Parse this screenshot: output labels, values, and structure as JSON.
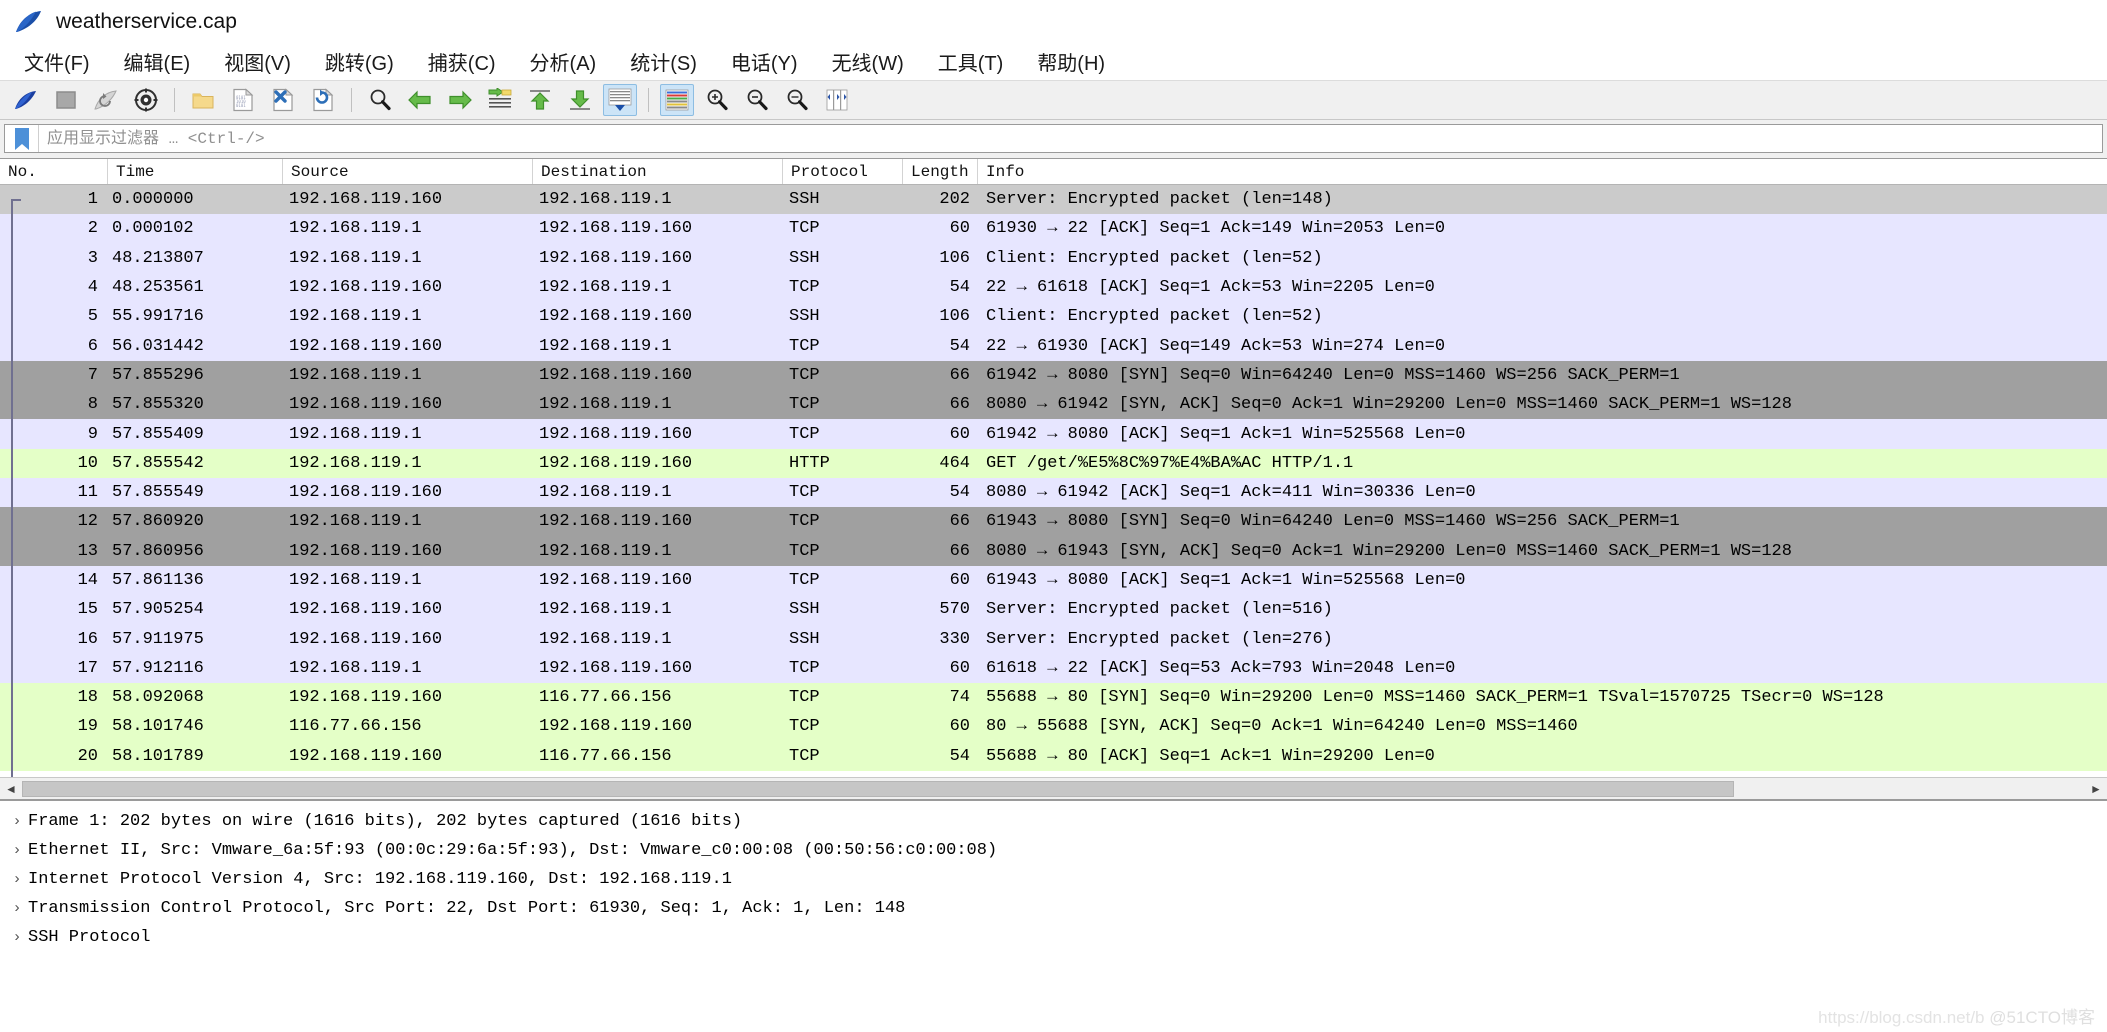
{
  "window": {
    "title": "weatherservice.cap",
    "app_icon": "wireshark-fin-icon"
  },
  "menubar": {
    "items": [
      {
        "label": "文件(F)",
        "name": "menu-file"
      },
      {
        "label": "编辑(E)",
        "name": "menu-edit"
      },
      {
        "label": "视图(V)",
        "name": "menu-view"
      },
      {
        "label": "跳转(G)",
        "name": "menu-go"
      },
      {
        "label": "捕获(C)",
        "name": "menu-capture"
      },
      {
        "label": "分析(A)",
        "name": "menu-analyze"
      },
      {
        "label": "统计(S)",
        "name": "menu-statistics"
      },
      {
        "label": "电话(Y)",
        "name": "menu-telephony"
      },
      {
        "label": "无线(W)",
        "name": "menu-wireless"
      },
      {
        "label": "工具(T)",
        "name": "menu-tools"
      },
      {
        "label": "帮助(H)",
        "name": "menu-help"
      }
    ]
  },
  "toolbar": {
    "buttons": [
      {
        "name": "start-capture-icon",
        "active": false
      },
      {
        "name": "stop-capture-icon",
        "active": false
      },
      {
        "name": "restart-capture-icon",
        "active": false
      },
      {
        "name": "capture-options-icon",
        "active": false
      },
      {
        "sep": true
      },
      {
        "name": "open-file-icon",
        "active": false
      },
      {
        "name": "save-file-icon",
        "active": false
      },
      {
        "name": "close-file-icon",
        "active": false
      },
      {
        "name": "reload-file-icon",
        "active": false
      },
      {
        "sep": true
      },
      {
        "name": "find-packet-icon",
        "active": false
      },
      {
        "name": "go-back-icon",
        "active": false
      },
      {
        "name": "go-forward-icon",
        "active": false
      },
      {
        "name": "go-to-packet-icon",
        "active": false
      },
      {
        "name": "go-to-first-packet-icon",
        "active": false
      },
      {
        "name": "go-to-last-packet-icon",
        "active": false
      },
      {
        "name": "auto-scroll-icon",
        "active": true
      },
      {
        "sep": true
      },
      {
        "name": "colorize-packets-icon",
        "active": true
      },
      {
        "name": "zoom-in-icon",
        "active": false
      },
      {
        "name": "zoom-out-icon",
        "active": false
      },
      {
        "name": "normal-size-icon",
        "active": false
      },
      {
        "name": "resize-columns-icon",
        "active": false
      }
    ]
  },
  "filter": {
    "bookmark_icon": "bookmark-icon",
    "value": "",
    "placeholder": "应用显示过滤器 … <Ctrl-/>"
  },
  "packet_list": {
    "columns": [
      "No.",
      "Time",
      "Source",
      "Destination",
      "Protocol",
      "Length",
      "Info"
    ],
    "rows": [
      {
        "no": "1",
        "time": "0.000000",
        "src": "192.168.119.160",
        "dst": "192.168.119.1",
        "proto": "SSH",
        "len": "202",
        "info": "Server: Encrypted packet (len=148)",
        "style": "selected"
      },
      {
        "no": "2",
        "time": "0.000102",
        "src": "192.168.119.1",
        "dst": "192.168.119.160",
        "proto": "TCP",
        "len": "60",
        "info": "61930 → 22 [ACK] Seq=1 Ack=149 Win=2053 Len=0",
        "style": "tcp"
      },
      {
        "no": "3",
        "time": "48.213807",
        "src": "192.168.119.1",
        "dst": "192.168.119.160",
        "proto": "SSH",
        "len": "106",
        "info": "Client: Encrypted packet (len=52)",
        "style": "tcp"
      },
      {
        "no": "4",
        "time": "48.253561",
        "src": "192.168.119.160",
        "dst": "192.168.119.1",
        "proto": "TCP",
        "len": "54",
        "info": "22 → 61618 [ACK] Seq=1 Ack=53 Win=2205 Len=0",
        "style": "tcp"
      },
      {
        "no": "5",
        "time": "55.991716",
        "src": "192.168.119.1",
        "dst": "192.168.119.160",
        "proto": "SSH",
        "len": "106",
        "info": "Client: Encrypted packet (len=52)",
        "style": "tcp"
      },
      {
        "no": "6",
        "time": "56.031442",
        "src": "192.168.119.160",
        "dst": "192.168.119.1",
        "proto": "TCP",
        "len": "54",
        "info": "22 → 61930 [ACK] Seq=149 Ack=53 Win=274 Len=0",
        "style": "tcp"
      },
      {
        "no": "7",
        "time": "57.855296",
        "src": "192.168.119.1",
        "dst": "192.168.119.160",
        "proto": "TCP",
        "len": "66",
        "info": "61942 → 8080 [SYN] Seq=0 Win=64240 Len=0 MSS=1460 WS=256 SACK_PERM=1",
        "style": "syn"
      },
      {
        "no": "8",
        "time": "57.855320",
        "src": "192.168.119.160",
        "dst": "192.168.119.1",
        "proto": "TCP",
        "len": "66",
        "info": "8080 → 61942 [SYN, ACK] Seq=0 Ack=1 Win=29200 Len=0 MSS=1460 SACK_PERM=1 WS=128",
        "style": "syn"
      },
      {
        "no": "9",
        "time": "57.855409",
        "src": "192.168.119.1",
        "dst": "192.168.119.160",
        "proto": "TCP",
        "len": "60",
        "info": "61942 → 8080 [ACK] Seq=1 Ack=1 Win=525568 Len=0",
        "style": "tcp"
      },
      {
        "no": "10",
        "time": "57.855542",
        "src": "192.168.119.1",
        "dst": "192.168.119.160",
        "proto": "HTTP",
        "len": "464",
        "info": "GET /get/%E5%8C%97%E4%BA%AC HTTP/1.1",
        "style": "http"
      },
      {
        "no": "11",
        "time": "57.855549",
        "src": "192.168.119.160",
        "dst": "192.168.119.1",
        "proto": "TCP",
        "len": "54",
        "info": "8080 → 61942 [ACK] Seq=1 Ack=411 Win=30336 Len=0",
        "style": "tcp"
      },
      {
        "no": "12",
        "time": "57.860920",
        "src": "192.168.119.1",
        "dst": "192.168.119.160",
        "proto": "TCP",
        "len": "66",
        "info": "61943 → 8080 [SYN] Seq=0 Win=64240 Len=0 MSS=1460 WS=256 SACK_PERM=1",
        "style": "syn"
      },
      {
        "no": "13",
        "time": "57.860956",
        "src": "192.168.119.160",
        "dst": "192.168.119.1",
        "proto": "TCP",
        "len": "66",
        "info": "8080 → 61943 [SYN, ACK] Seq=0 Ack=1 Win=29200 Len=0 MSS=1460 SACK_PERM=1 WS=128",
        "style": "syn"
      },
      {
        "no": "14",
        "time": "57.861136",
        "src": "192.168.119.1",
        "dst": "192.168.119.160",
        "proto": "TCP",
        "len": "60",
        "info": "61943 → 8080 [ACK] Seq=1 Ack=1 Win=525568 Len=0",
        "style": "tcp"
      },
      {
        "no": "15",
        "time": "57.905254",
        "src": "192.168.119.160",
        "dst": "192.168.119.1",
        "proto": "SSH",
        "len": "570",
        "info": "Server: Encrypted packet (len=516)",
        "style": "tcp"
      },
      {
        "no": "16",
        "time": "57.911975",
        "src": "192.168.119.160",
        "dst": "192.168.119.1",
        "proto": "SSH",
        "len": "330",
        "info": "Server: Encrypted packet (len=276)",
        "style": "tcp"
      },
      {
        "no": "17",
        "time": "57.912116",
        "src": "192.168.119.1",
        "dst": "192.168.119.160",
        "proto": "TCP",
        "len": "60",
        "info": "61618 → 22 [ACK] Seq=53 Ack=793 Win=2048 Len=0",
        "style": "tcp"
      },
      {
        "no": "18",
        "time": "58.092068",
        "src": "192.168.119.160",
        "dst": "116.77.66.156",
        "proto": "TCP",
        "len": "74",
        "info": "55688 → 80 [SYN] Seq=0 Win=29200 Len=0 MSS=1460 SACK_PERM=1 TSval=1570725 TSecr=0 WS=128",
        "style": "http"
      },
      {
        "no": "19",
        "time": "58.101746",
        "src": "116.77.66.156",
        "dst": "192.168.119.160",
        "proto": "TCP",
        "len": "60",
        "info": "80 → 55688 [SYN, ACK] Seq=0 Ack=1 Win=64240 Len=0 MSS=1460",
        "style": "http"
      },
      {
        "no": "20",
        "time": "58.101789",
        "src": "192.168.119.160",
        "dst": "116.77.66.156",
        "proto": "TCP",
        "len": "54",
        "info": "55688 → 80 [ACK] Seq=1 Ack=1 Win=29200 Len=0",
        "style": "http"
      }
    ]
  },
  "detail_pane": {
    "rows": [
      {
        "twisty": "›",
        "text": "Frame 1: 202 bytes on wire (1616 bits), 202 bytes captured (1616 bits)"
      },
      {
        "twisty": "›",
        "text": "Ethernet II, Src: Vmware_6a:5f:93 (00:0c:29:6a:5f:93), Dst: Vmware_c0:00:08 (00:50:56:c0:00:08)"
      },
      {
        "twisty": "›",
        "text": "Internet Protocol Version 4, Src: 192.168.119.160, Dst: 192.168.119.1"
      },
      {
        "twisty": "›",
        "text": "Transmission Control Protocol, Src Port: 22, Dst Port: 61930, Seq: 1, Ack: 1, Len: 148"
      },
      {
        "twisty": "›",
        "text": "SSH Protocol"
      }
    ]
  },
  "scrollbar": {
    "left_arrow": "◄",
    "right_arrow": "►"
  },
  "watermark": {
    "url": "https://blog.csdn.net/b",
    "site": "@51CTO博客"
  },
  "colors": {
    "tcp_row": "#e7e6ff",
    "syn_row": "#a0a0a0",
    "http_row": "#e4ffc7",
    "selected_row": "#cbcbcb",
    "toolbar_bg": "#f0f0f0",
    "accent": "#2f5ea8"
  }
}
